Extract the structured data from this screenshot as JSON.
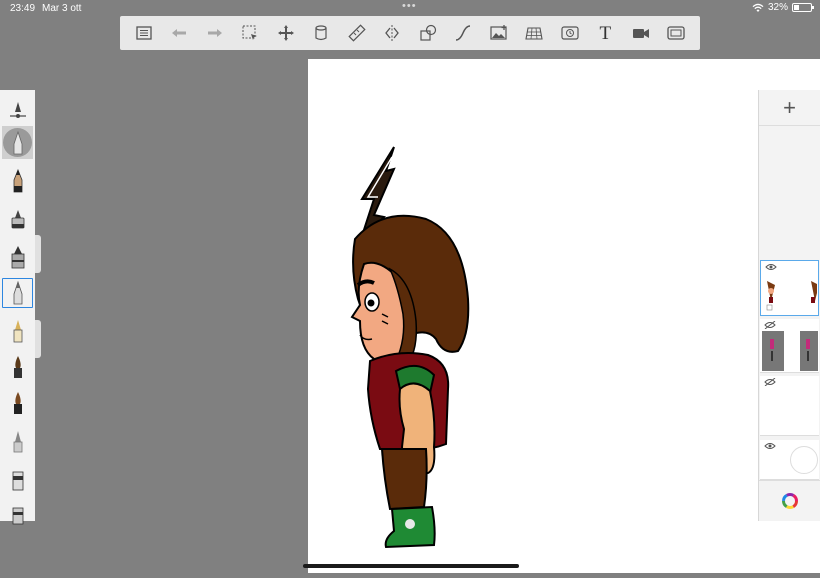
{
  "status_bar": {
    "time": "23:49",
    "date": "Mar 3 ott",
    "multitask_dots": "•••",
    "battery_percent": "32%",
    "battery_level": 0.32
  },
  "toolbar": {
    "tools": [
      {
        "name": "layers-list",
        "icon": "list-icon"
      },
      {
        "name": "undo",
        "icon": "undo-arrow-icon"
      },
      {
        "name": "redo",
        "icon": "redo-arrow-icon"
      },
      {
        "name": "selection",
        "icon": "selection-icon"
      },
      {
        "name": "transform",
        "icon": "move-arrows-icon"
      },
      {
        "name": "fill",
        "icon": "fill-bucket-icon"
      },
      {
        "name": "ruler",
        "icon": "ruler-icon"
      },
      {
        "name": "symmetry",
        "icon": "symmetry-icon"
      },
      {
        "name": "shapes",
        "icon": "shapes-icon"
      },
      {
        "name": "curve",
        "icon": "curve-icon"
      },
      {
        "name": "import-image",
        "icon": "image-icon"
      },
      {
        "name": "perspective",
        "icon": "perspective-grid-icon"
      },
      {
        "name": "time-lapse",
        "icon": "clock-icon"
      },
      {
        "name": "text",
        "icon": "text-icon",
        "label": "T"
      },
      {
        "name": "record",
        "icon": "video-icon"
      },
      {
        "name": "fullscreen",
        "icon": "fullscreen-icon"
      }
    ],
    "colors": {
      "icon": "#555555",
      "disabled": "#a0a0a0"
    }
  },
  "brush_panel": {
    "brushes": [
      {
        "name": "opacity-slider",
        "icon": "opacity-slider-icon"
      },
      {
        "name": "pencil",
        "icon": "pencil-icon"
      },
      {
        "name": "airbrush",
        "icon": "airbrush-icon"
      },
      {
        "name": "paint-brush",
        "icon": "paint-brush-icon"
      },
      {
        "name": "marker",
        "icon": "marker-icon"
      },
      {
        "name": "fountain-pen",
        "icon": "fountain-pen-icon"
      },
      {
        "name": "ink-brush",
        "icon": "ink-brush-icon"
      },
      {
        "name": "flat-brush",
        "icon": "flat-brush-icon"
      },
      {
        "name": "soft-eraser",
        "icon": "soft-eraser-icon"
      },
      {
        "name": "hard-eraser",
        "icon": "hard-eraser-icon"
      },
      {
        "name": "smudge",
        "icon": "smudge-icon"
      }
    ],
    "selected": "airbrush",
    "accent": "#2d86e0"
  },
  "layers_panel": {
    "add_label": "+",
    "layers": [
      {
        "name": "layer-1",
        "visible": true,
        "selected": true
      },
      {
        "name": "layer-2",
        "visible": false,
        "selected": false
      },
      {
        "name": "layer-3",
        "visible": false,
        "selected": false
      },
      {
        "name": "background-layer",
        "visible": true,
        "selected": false
      }
    ],
    "color_button_icon": "color-wheel-icon"
  },
  "canvas": {
    "background": "#ffffff",
    "artwork": "cartoon-boy-side-view"
  }
}
